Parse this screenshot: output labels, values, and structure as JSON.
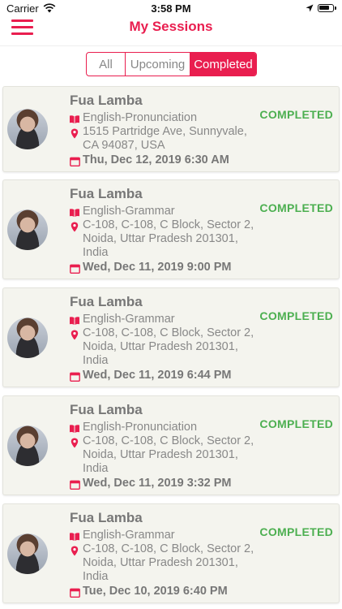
{
  "status_bar": {
    "carrier": "Carrier",
    "time": "3:58 PM"
  },
  "nav": {
    "title": "My Sessions",
    "menu_icon": "hamburger-icon"
  },
  "tabs": [
    {
      "label": "All",
      "active": false
    },
    {
      "label": "Upcoming",
      "active": false
    },
    {
      "label": "Completed",
      "active": true
    }
  ],
  "colors": {
    "accent": "#e91e4f",
    "completed": "#4caf50"
  },
  "sessions": [
    {
      "name": "Fua Lamba",
      "subject": "English-Pronunciation",
      "address": "1515 Partridge Ave, Sunnyvale, CA 94087, USA",
      "date": "Thu, Dec 12, 2019 6:30 AM",
      "status": "COMPLETED"
    },
    {
      "name": "Fua Lamba",
      "subject": "English-Grammar",
      "address": "C-108, C-108, C Block, Sector 2, Noida, Uttar Pradesh 201301, India",
      "date": "Wed, Dec 11, 2019 9:00 PM",
      "status": "COMPLETED"
    },
    {
      "name": "Fua Lamba",
      "subject": "English-Grammar",
      "address": "C-108, C-108, C Block, Sector 2, Noida, Uttar Pradesh 201301, India",
      "date": "Wed, Dec 11, 2019 6:44 PM",
      "status": "COMPLETED"
    },
    {
      "name": "Fua Lamba",
      "subject": "English-Pronunciation",
      "address": "C-108, C-108, C Block, Sector 2, Noida, Uttar Pradesh 201301, India",
      "date": "Wed, Dec 11, 2019 3:32 PM",
      "status": "COMPLETED"
    },
    {
      "name": "Fua Lamba",
      "subject": "English-Grammar",
      "address": "C-108, C-108, C Block, Sector 2, Noida, Uttar Pradesh 201301, India",
      "date": "Tue, Dec 10, 2019 6:40 PM",
      "status": "COMPLETED"
    }
  ]
}
